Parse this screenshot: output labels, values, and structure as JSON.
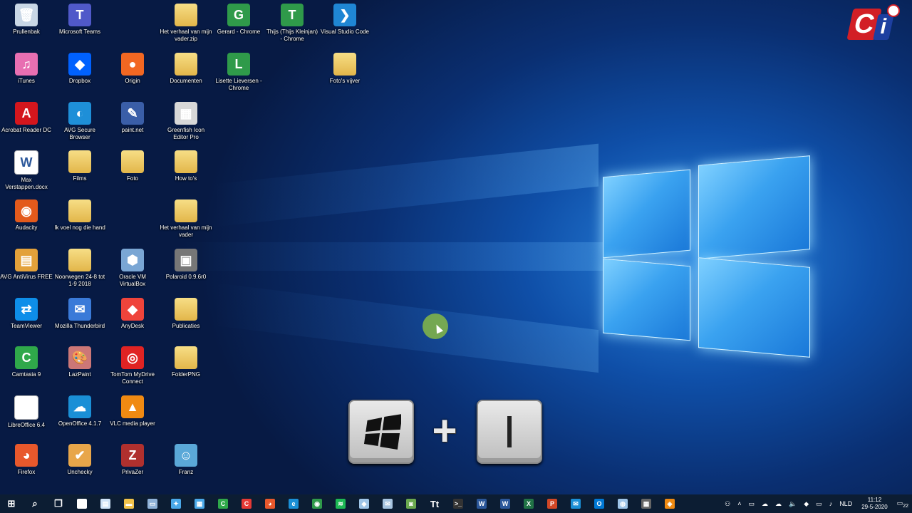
{
  "desktop": {
    "icons": [
      {
        "label": "Prullenbak",
        "icon": "recycle-bin-icon",
        "color": "#c9d7e6",
        "glyph": "🗑"
      },
      {
        "label": "Microsoft Teams",
        "icon": "teams-icon",
        "color": "#5059c9",
        "glyph": "T"
      },
      {
        "label": "Het verhaal van mijn vader.zip",
        "icon": "zip-folder-icon",
        "color": "folder",
        "glyph": ""
      },
      {
        "label": "Gerard - Chrome",
        "icon": "chrome-icon",
        "color": "#2f9a4a",
        "glyph": "G"
      },
      {
        "label": "Thijs (Thijs Kleinjan) - Chrome",
        "icon": "chrome-icon",
        "color": "#2f9a4a",
        "glyph": "T"
      },
      {
        "label": "Visual Studio Code",
        "icon": "vscode-icon",
        "color": "#1f86d4",
        "glyph": "❯"
      },
      {
        "label": "iTunes",
        "icon": "itunes-icon",
        "color": "#e86fb2",
        "glyph": "♫"
      },
      {
        "label": "Dropbox",
        "icon": "dropbox-icon",
        "color": "#0061fe",
        "glyph": "◆"
      },
      {
        "label": "Origin",
        "icon": "origin-icon",
        "color": "#f26722",
        "glyph": "●"
      },
      {
        "label": "Documenten",
        "icon": "folder-icon",
        "color": "folder",
        "glyph": ""
      },
      {
        "label": "Lisette Lieversen - Chrome",
        "icon": "chrome-icon",
        "color": "#2f9a4a",
        "glyph": "L"
      },
      {
        "label": "Foto's vijver",
        "icon": "folder-icon",
        "color": "folder",
        "glyph": ""
      },
      {
        "label": "Acrobat Reader DC",
        "icon": "acrobat-icon",
        "color": "#d4161d",
        "glyph": "A"
      },
      {
        "label": "AVG Secure Browser",
        "icon": "avg-browser-icon",
        "color": "#1e8fd8",
        "glyph": "◐"
      },
      {
        "label": "paint.net",
        "icon": "paintnet-icon",
        "color": "#3a5ea8",
        "glyph": "✎"
      },
      {
        "label": "Greenfish Icon Editor Pro",
        "icon": "greenfish-icon",
        "color": "#d8d8d8",
        "glyph": "▦"
      },
      {
        "label": "Max Verstappen.docx",
        "icon": "word-doc-icon",
        "color": "doc",
        "glyph": "W"
      },
      {
        "label": "Films",
        "icon": "folder-icon",
        "color": "folder",
        "glyph": ""
      },
      {
        "label": "Foto",
        "icon": "folder-icon",
        "color": "folder",
        "glyph": ""
      },
      {
        "label": "How to's",
        "icon": "folder-icon",
        "color": "folder",
        "glyph": ""
      },
      {
        "label": "Audacity",
        "icon": "audacity-icon",
        "color": "#e35a1c",
        "glyph": "◉"
      },
      {
        "label": "Ik voel nog die hand",
        "icon": "folder-icon",
        "color": "folder",
        "glyph": ""
      },
      {
        "label": "Het verhaal van mijn vader",
        "icon": "folder-icon",
        "color": "folder",
        "glyph": ""
      },
      {
        "label": "AVG AntiVirus FREE",
        "icon": "avg-icon",
        "color": "#e3a13a",
        "glyph": "▤"
      },
      {
        "label": "Noorwegen 24-8 tot 1-9 2018",
        "icon": "folder-icon",
        "color": "folder",
        "glyph": ""
      },
      {
        "label": "Oracle VM VirtualBox",
        "icon": "virtualbox-icon",
        "color": "#7aa6d4",
        "glyph": "⬢"
      },
      {
        "label": "Polaroid 0.9.6r0",
        "icon": "poladroid-icon",
        "color": "#777",
        "glyph": "▣"
      },
      {
        "label": "TeamViewer",
        "icon": "teamviewer-icon",
        "color": "#0e8ee9",
        "glyph": "⇄"
      },
      {
        "label": "Mozilla Thunderbird",
        "icon": "thunderbird-icon",
        "color": "#3a7ad8",
        "glyph": "✉"
      },
      {
        "label": "AnyDesk",
        "icon": "anydesk-icon",
        "color": "#ef443b",
        "glyph": "◆"
      },
      {
        "label": "Publicaties",
        "icon": "folder-icon",
        "color": "folder",
        "glyph": ""
      },
      {
        "label": "Camtasia 9",
        "icon": "camtasia-icon",
        "color": "#2fa84a",
        "glyph": "C"
      },
      {
        "label": "LazPaint",
        "icon": "lazpaint-icon",
        "color": "#c77",
        "glyph": "🎨"
      },
      {
        "label": "TomTom MyDrive Connect",
        "icon": "tomtom-icon",
        "color": "#e02323",
        "glyph": "◎"
      },
      {
        "label": "FolderPNG",
        "icon": "folder-icon",
        "color": "folder",
        "glyph": ""
      },
      {
        "label": "LibreOffice 6.4",
        "icon": "libreoffice-icon",
        "color": "doc",
        "glyph": ""
      },
      {
        "label": "OpenOffice 4.1.7",
        "icon": "openoffice-icon",
        "color": "#1a8fd6",
        "glyph": "☁"
      },
      {
        "label": "VLC media player",
        "icon": "vlc-icon",
        "color": "#f08a12",
        "glyph": "▲"
      },
      {
        "label": "Firefox",
        "icon": "firefox-icon",
        "color": "#e8582c",
        "glyph": "◕"
      },
      {
        "label": "Unchecky",
        "icon": "unchecky-icon",
        "color": "#e8a64a",
        "glyph": "✔"
      },
      {
        "label": "PrivaZer",
        "icon": "privazer-icon",
        "color": "#b0302e",
        "glyph": "Z"
      },
      {
        "label": "Franz",
        "icon": "franz-icon",
        "color": "#5aa8d8",
        "glyph": "☺"
      }
    ]
  },
  "overlay": {
    "windows_key_label": "",
    "plus": "+",
    "second_key_label": "I"
  },
  "logo": {
    "c": "C",
    "i": "i"
  },
  "taskbar": {
    "apps": [
      {
        "name": "start-button",
        "glyph": "⊞",
        "color": ""
      },
      {
        "name": "search-icon",
        "glyph": "⌕",
        "color": ""
      },
      {
        "name": "task-view-icon",
        "glyph": "❐",
        "color": ""
      },
      {
        "name": "store-icon",
        "glyph": "▣",
        "color": "#ffffff"
      },
      {
        "name": "notepad-icon",
        "glyph": "▤",
        "color": "#cfe3f7"
      },
      {
        "name": "file-explorer-icon",
        "glyph": "▬",
        "color": "#f1c24a"
      },
      {
        "name": "window-app-icon",
        "glyph": "▭",
        "color": "#8fb2d8"
      },
      {
        "name": "tool-app-icon",
        "glyph": "✦",
        "color": "#4aa8e8"
      },
      {
        "name": "screenshot-app-icon",
        "glyph": "▦",
        "color": "#4aa8e8"
      },
      {
        "name": "camtasia-icon",
        "glyph": "C",
        "color": "#2fa84a"
      },
      {
        "name": "camtasia-recorder-icon",
        "glyph": "C",
        "color": "#e53935"
      },
      {
        "name": "firefox-icon",
        "glyph": "◕",
        "color": "#e8582c"
      },
      {
        "name": "edge-icon",
        "glyph": "e",
        "color": "#1a8fd6"
      },
      {
        "name": "chrome-icon",
        "glyph": "◉",
        "color": "#2f9a4a"
      },
      {
        "name": "spotify-icon",
        "glyph": "≋",
        "color": "#1db954"
      },
      {
        "name": "app-icon",
        "glyph": "◆",
        "color": "#9fc5e8"
      },
      {
        "name": "thunderbird-icon",
        "glyph": "✉",
        "color": "#a7c4e0"
      },
      {
        "name": "greenshot-icon",
        "glyph": "◙",
        "color": "#6aa84f"
      },
      {
        "name": "text-app-icon",
        "glyph": "Tt",
        "color": ""
      },
      {
        "name": "terminal-icon",
        "glyph": ">_",
        "color": "#333"
      },
      {
        "name": "word-icon-1",
        "glyph": "W",
        "color": "#2b579a"
      },
      {
        "name": "word-icon",
        "glyph": "W",
        "color": "#2b579a"
      },
      {
        "name": "excel-icon",
        "glyph": "X",
        "color": "#217346"
      },
      {
        "name": "powerpoint-icon",
        "glyph": "P",
        "color": "#d24726"
      },
      {
        "name": "mail-icon",
        "glyph": "✉",
        "color": "#1a8fd6"
      },
      {
        "name": "outlook-icon",
        "glyph": "O",
        "color": "#0078d4"
      },
      {
        "name": "network-app-icon",
        "glyph": "◍",
        "color": "#9fc5e8"
      },
      {
        "name": "calculator-icon",
        "glyph": "▦",
        "color": "#666"
      },
      {
        "name": "orange-app-icon",
        "glyph": "◈",
        "color": "#f08a12"
      }
    ],
    "tray": {
      "language": "NLD",
      "time": "11:12",
      "date": "29-5-2020",
      "notifications": "22"
    }
  }
}
